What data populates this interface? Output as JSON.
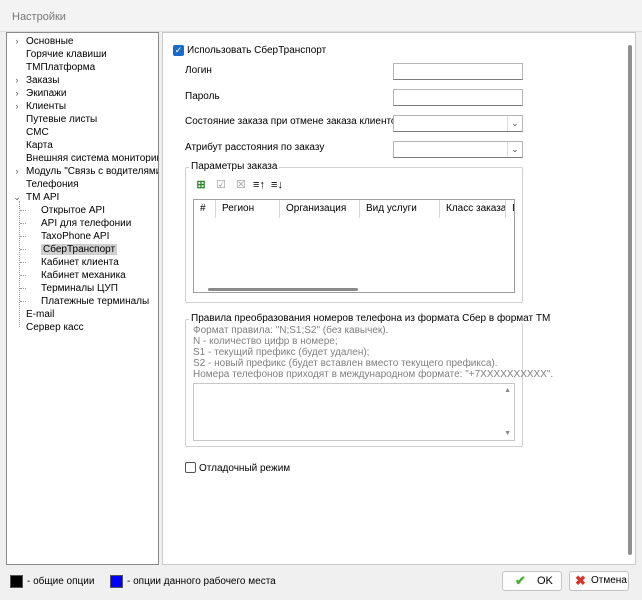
{
  "window": {
    "title": "Настройки"
  },
  "tree": {
    "items": [
      {
        "label": "Основные",
        "arrow": "›"
      },
      {
        "label": "Горячие клавиши",
        "arrow": ""
      },
      {
        "label": "ТМПлатформа",
        "arrow": ""
      },
      {
        "label": "Заказы",
        "arrow": "›"
      },
      {
        "label": "Экипажи",
        "arrow": "›"
      },
      {
        "label": "Клиенты",
        "arrow": "›"
      },
      {
        "label": "Путевые листы",
        "arrow": ""
      },
      {
        "label": "СМС",
        "arrow": ""
      },
      {
        "label": "Карта",
        "arrow": ""
      },
      {
        "label": "Внешняя система мониторинга",
        "arrow": ""
      },
      {
        "label": "Модуль \"Связь с водителями\"",
        "arrow": "›"
      },
      {
        "label": "Телефония",
        "arrow": ""
      },
      {
        "label": "ТМ API",
        "arrow": "⌄"
      },
      {
        "label": "Открытое API",
        "arrow": ""
      },
      {
        "label": "API для телефонии",
        "arrow": ""
      },
      {
        "label": "TaxoPhone API",
        "arrow": ""
      },
      {
        "label": "СберТранспорт",
        "arrow": ""
      },
      {
        "label": "Кабинет клиента",
        "arrow": ""
      },
      {
        "label": "Кабинет механика",
        "arrow": ""
      },
      {
        "label": "Терминалы ЦУП",
        "arrow": ""
      },
      {
        "label": "Платежные терминалы",
        "arrow": ""
      },
      {
        "label": "E-mail",
        "arrow": ""
      },
      {
        "label": "Сервер касс",
        "arrow": ""
      }
    ],
    "selected": "СберТранспорт"
  },
  "settings": {
    "use_sber_label": "Использовать СберТранспорт",
    "use_sber_checked": true,
    "login_label": "Логин",
    "login_value": "",
    "password_label": "Пароль",
    "password_value": "",
    "cancel_state_label": "Состояние заказа при отмене заказа клиентом",
    "cancel_state_value": "",
    "distance_attr_label": "Атрибут расстояния по заказу",
    "distance_attr_value": ""
  },
  "order_params": {
    "title": "Параметры заказа",
    "toolbar_icons": [
      "add-icon",
      "edit-icon",
      "delete-icon",
      "move-up-icon",
      "move-down-icon"
    ],
    "columns": [
      "#",
      "Регион",
      "Организация",
      "Вид услуги",
      "Класс заказа",
      "Ι"
    ]
  },
  "phone_rules": {
    "title": "Правила преобразования номеров телефона из формата Сбер в формат ТМ",
    "hint_lines": [
      "Формат правила: \"N;S1;S2\" (без кавычек).",
      "N - количество цифр в номере;",
      "S1 - текущий префикс (будет удален);",
      "S2 - новый префикс (будет вставлен вместо текущего префикса).",
      "Номера телефонов приходят в международном формате: \"+7XXXXXXXXXX\"."
    ],
    "rules_value": ""
  },
  "debug": {
    "label": "Отладочный режим",
    "checked": false
  },
  "footer": {
    "legend_common": "- общие опции",
    "legend_workplace": "- опции данного рабочего места",
    "legend_common_color": "#000000",
    "legend_workplace_color": "#0000ff",
    "ok_label": "OK",
    "cancel_label": "Отмена"
  },
  "colors": {
    "accent": "#1a6bc8",
    "ok_icon": "#4caf2f",
    "cancel_icon": "#d9342b"
  }
}
